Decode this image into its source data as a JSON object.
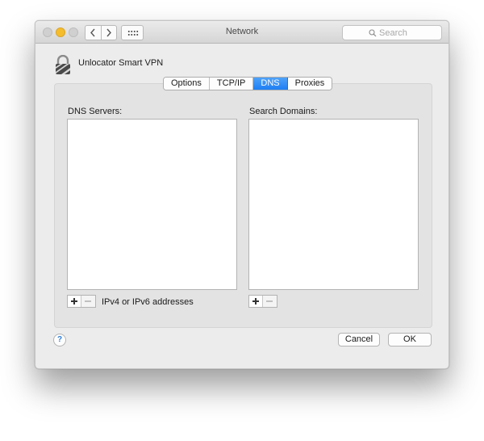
{
  "window": {
    "title": "Network",
    "search_placeholder": "Search"
  },
  "service": {
    "name": "Unlocator Smart VPN"
  },
  "tabs": [
    {
      "label": "Options",
      "active": false
    },
    {
      "label": "TCP/IP",
      "active": false
    },
    {
      "label": "DNS",
      "active": true
    },
    {
      "label": "Proxies",
      "active": false
    }
  ],
  "dns": {
    "servers_label": "DNS Servers:",
    "search_domains_label": "Search Domains:",
    "servers": [],
    "search_domains": [],
    "address_hint": "IPv4 or IPv6 addresses"
  },
  "footer": {
    "help_label": "?",
    "cancel_label": "Cancel",
    "ok_label": "OK"
  },
  "icons": [
    "close-icon",
    "minimize-icon",
    "zoom-icon",
    "back-arrow-icon",
    "forward-arrow-icon",
    "show-all-grid-icon",
    "search-icon",
    "vpn-lock-icon",
    "plus-icon",
    "minus-icon",
    "help-icon"
  ],
  "colors": {
    "accent_tab": "#1e7ef3",
    "minimize_light": "#f5bd2c",
    "window_bg": "#ececec"
  }
}
